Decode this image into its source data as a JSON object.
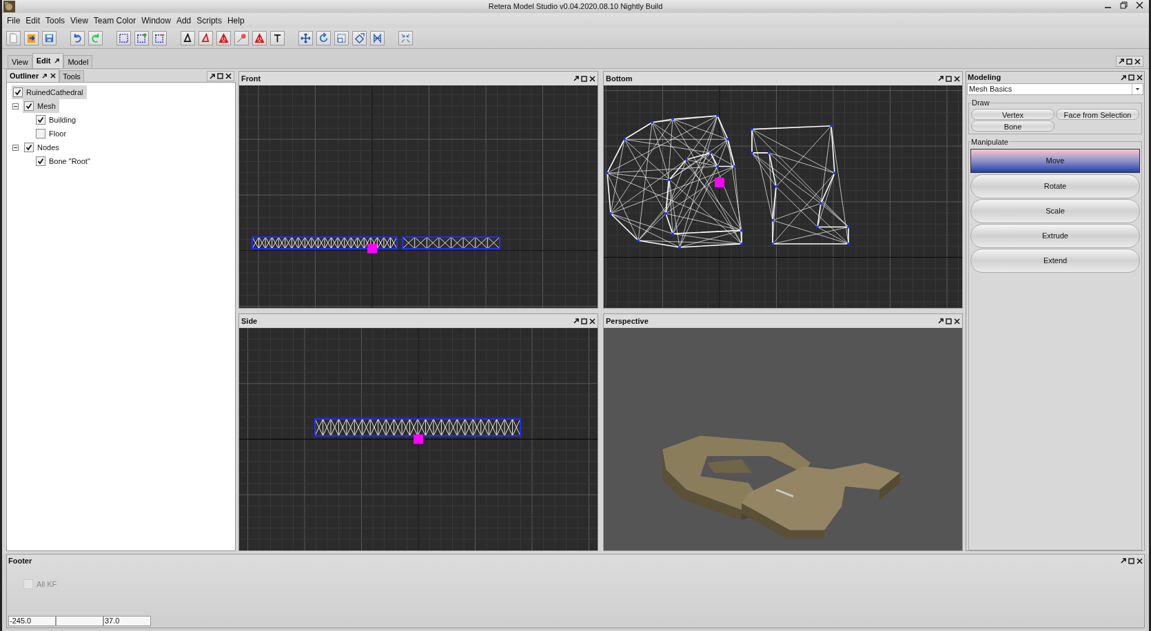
{
  "window": {
    "title": "Retera Model Studio v0.04.2020.08.10 Nightly Build"
  },
  "menu": [
    "File",
    "Edit",
    "Tools",
    "View",
    "Team Color",
    "Window",
    "Add",
    "Scripts",
    "Help"
  ],
  "main_tabs": [
    {
      "label": "View",
      "selected": false
    },
    {
      "label": "Edit",
      "selected": true
    },
    {
      "label": "Model",
      "selected": false
    }
  ],
  "left_tabs": [
    {
      "label": "Outliner",
      "selected": true
    },
    {
      "label": "Tools",
      "selected": false
    }
  ],
  "tree": [
    {
      "label": "RuinedCathedral",
      "checked": true,
      "selected": true,
      "children": [
        {
          "label": "Mesh",
          "checked": true,
          "selected": true,
          "expanded": true,
          "children": [
            {
              "label": "Building",
              "checked": true,
              "selected": false
            },
            {
              "label": "Floor",
              "checked": false,
              "selected": false
            }
          ]
        },
        {
          "label": "Nodes",
          "checked": true,
          "selected": false,
          "expanded": true,
          "children": [
            {
              "label": "Bone \"Root\"",
              "checked": true,
              "selected": false
            }
          ]
        }
      ]
    }
  ],
  "viewports": [
    {
      "title": "Front",
      "kind": "front"
    },
    {
      "title": "Bottom",
      "kind": "bottom"
    },
    {
      "title": "Side",
      "kind": "side"
    },
    {
      "title": "Perspective",
      "kind": "perspective"
    }
  ],
  "modeling": {
    "title": "Modeling",
    "mode": "Mesh Basics",
    "draw_label": "Draw",
    "draw_buttons": [
      "Vertex",
      "Face from Selection",
      "Bone"
    ],
    "manipulate_label": "Manipulate",
    "manipulate_buttons": [
      {
        "label": "Move",
        "selected": true
      },
      {
        "label": "Rotate",
        "selected": false
      },
      {
        "label": "Scale",
        "selected": false
      },
      {
        "label": "Extrude",
        "selected": false
      },
      {
        "label": "Extend",
        "selected": false
      }
    ]
  },
  "footer": {
    "title": "Footer",
    "checkbox": {
      "label": "All KF",
      "checked": false,
      "disabled": true
    },
    "fields": [
      {
        "kind": "value",
        "value": "-245.0"
      },
      {
        "kind": "blank"
      },
      {
        "kind": "value",
        "value": "37.0"
      }
    ]
  }
}
